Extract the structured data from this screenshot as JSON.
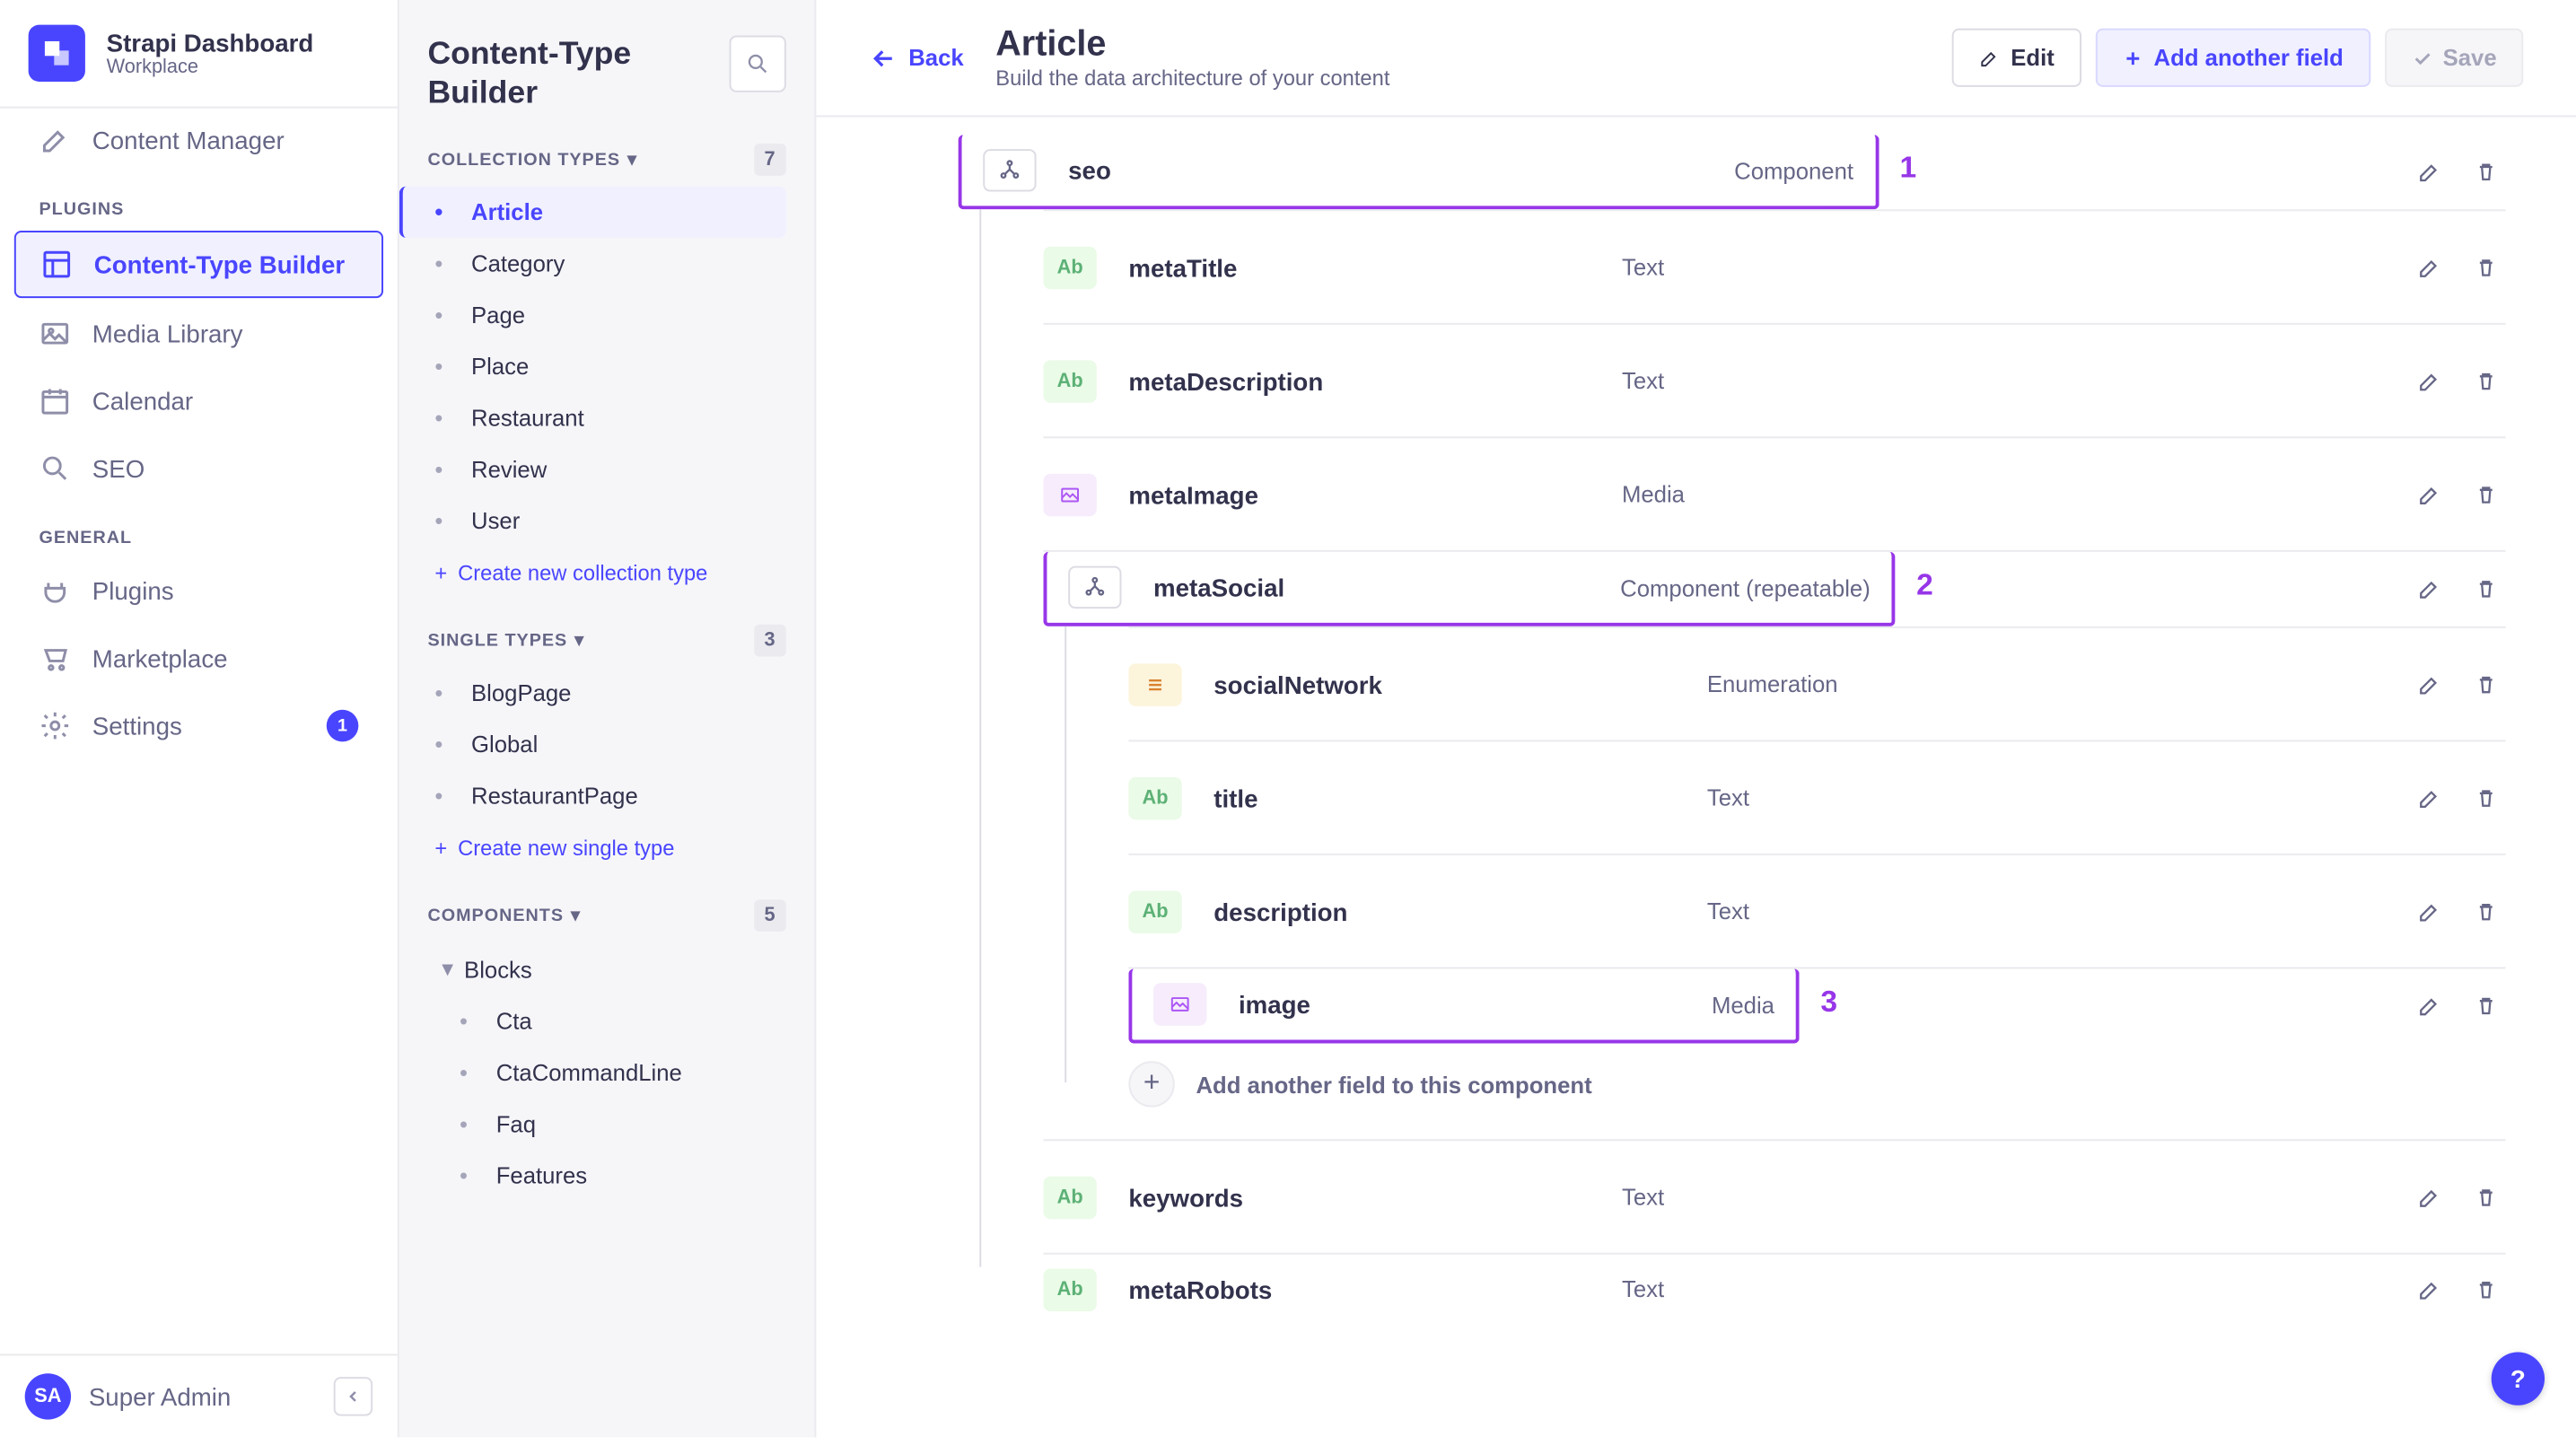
{
  "brand": {
    "title": "Strapi Dashboard",
    "subtitle": "Workplace"
  },
  "nav": {
    "contentManager": "Content Manager",
    "pluginsLabel": "PLUGINS",
    "contentTypeBuilder": "Content-Type Builder",
    "mediaLibrary": "Media Library",
    "calendar": "Calendar",
    "seo": "SEO",
    "generalLabel": "GENERAL",
    "plugins": "Plugins",
    "marketplace": "Marketplace",
    "settings": "Settings",
    "settingsBadge": "1"
  },
  "user": {
    "initials": "SA",
    "name": "Super Admin"
  },
  "subnav": {
    "title": "Content-Type Builder",
    "groups": {
      "collection": {
        "label": "COLLECTION TYPES",
        "badge": "7",
        "items": [
          "Article",
          "Category",
          "Page",
          "Place",
          "Restaurant",
          "Review",
          "User"
        ],
        "create": "Create new collection type"
      },
      "single": {
        "label": "SINGLE TYPES",
        "badge": "3",
        "items": [
          "BlogPage",
          "Global",
          "RestaurantPage"
        ],
        "create": "Create new single type"
      },
      "components": {
        "label": "COMPONENTS",
        "badge": "5",
        "groupName": "Blocks",
        "items": [
          "Cta",
          "CtaCommandLine",
          "Faq",
          "Features"
        ]
      }
    }
  },
  "header": {
    "back": "Back",
    "title": "Article",
    "subtitle": "Build the data architecture of your content",
    "edit": "Edit",
    "addField": "Add another field",
    "save": "Save"
  },
  "types": {
    "text": "Text",
    "media": "Media",
    "component": "Component",
    "componentRepeatable": "Component (repeatable)",
    "enumeration": "Enumeration"
  },
  "icons": {
    "text": "Ab",
    "media": "▣",
    "enum": "≡",
    "comp": "⋔"
  },
  "fields": {
    "seo": {
      "name": "seo"
    },
    "metaTitle": {
      "name": "metaTitle"
    },
    "metaDescription": {
      "name": "metaDescription"
    },
    "metaImage": {
      "name": "metaImage"
    },
    "metaSocial": {
      "name": "metaSocial"
    },
    "socialNetwork": {
      "name": "socialNetwork"
    },
    "title": {
      "name": "title"
    },
    "description": {
      "name": "description"
    },
    "image": {
      "name": "image"
    },
    "keywords": {
      "name": "keywords"
    },
    "metaRobots": {
      "name": "metaRobots"
    }
  },
  "annotate": {
    "one": "1",
    "two": "2",
    "three": "3"
  },
  "addSub": "Add another field to this component",
  "help": "?"
}
